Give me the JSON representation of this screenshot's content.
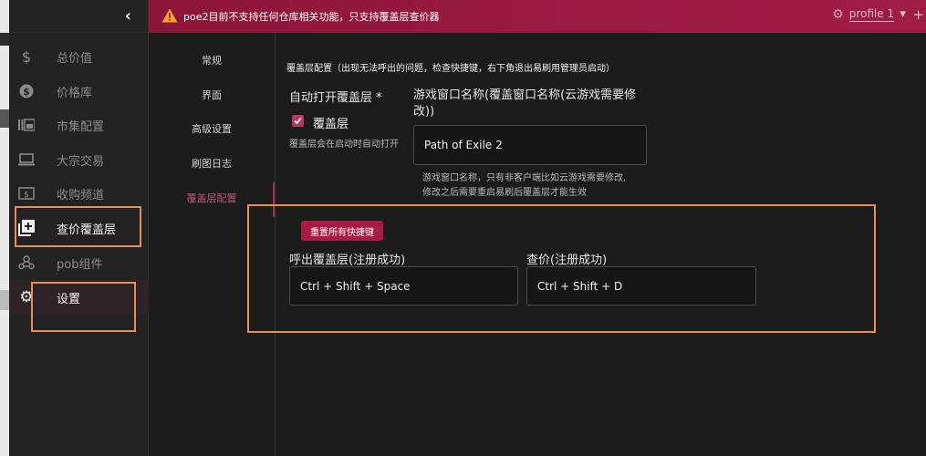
{
  "sidebar": {
    "items": [
      {
        "label": "总价值",
        "icon": "dollar-icon"
      },
      {
        "label": "价格库",
        "icon": "dollar-circle-icon"
      },
      {
        "label": "市集配置",
        "icon": "market-icon"
      },
      {
        "label": "大宗交易",
        "icon": "laptop-icon"
      },
      {
        "label": "收购频道",
        "icon": "money-icon"
      },
      {
        "label": "查价覆盖层",
        "icon": "add-box-icon"
      },
      {
        "label": "pob组件",
        "icon": "webhook-icon"
      },
      {
        "label": "设置",
        "icon": "gear-icon"
      }
    ]
  },
  "topbar": {
    "warning": "poe2目前不支持任何仓库相关功能，只支持覆盖层查价器",
    "profile": "profile 1"
  },
  "tabs": [
    "常规",
    "界面",
    "高级设置",
    "刷图日志",
    "覆盖层配置"
  ],
  "overlay": {
    "section_title": "覆盖层配置（出现无法呼出的问题，检查快捷键，右下角退出易刷用管理员启动）",
    "auto_open_label": "自动打开覆盖层 *",
    "checkbox_label": "覆盖层",
    "auto_open_hint": "覆盖层会在启动时自动打开",
    "window_name_label": "游戏窗口名称(覆盖窗口名称(云游戏需要修改))",
    "window_name_value": "Path of Exile 2",
    "window_name_hint_1": "游戏窗口名称，只有非客户端比如云游戏需要修改,",
    "window_name_hint_2": "修改之后需要重启易刷后覆盖层才能生效",
    "reset_button": "重置所有快捷键",
    "hotkey_open_label": "呼出覆盖层(注册成功)",
    "hotkey_open_value": "Ctrl + Shift + Space",
    "hotkey_price_label": "查价(注册成功)",
    "hotkey_price_value": "Ctrl + Shift + D"
  },
  "colors": {
    "accent": "#a81c45",
    "annotation": "#e88e55"
  }
}
